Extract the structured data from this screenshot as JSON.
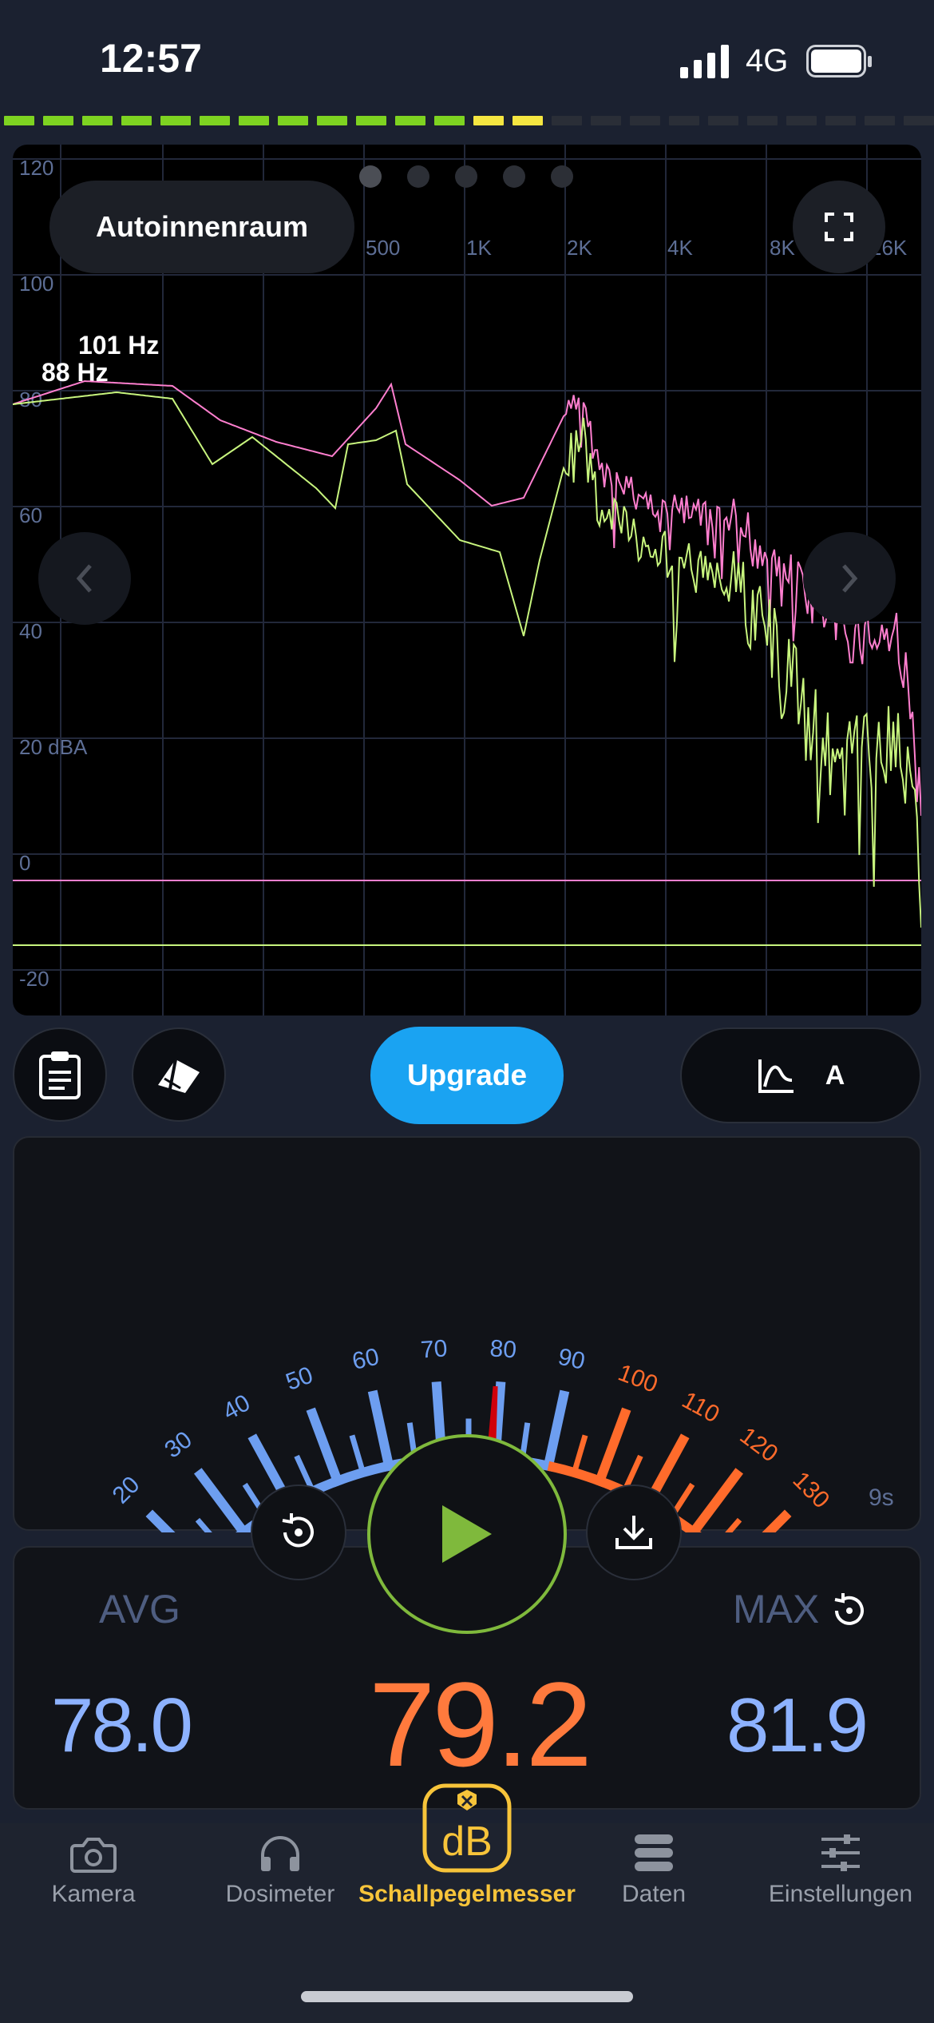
{
  "status": {
    "time": "12:57",
    "network": "4G"
  },
  "spectrum": {
    "preset_label": "Autoinnenraum",
    "y_ticks": [
      "120",
      "100",
      "80",
      "60",
      "40",
      "20 dBA",
      "0",
      "-20"
    ],
    "x_ticks": [
      "500",
      "1K",
      "2K",
      "4K",
      "8K",
      "16K"
    ],
    "peak_labels": [
      "101 Hz",
      "88 Hz"
    ],
    "colors": {
      "max_trace": "#ff7fcf",
      "current_trace": "#c8f57e",
      "grid": "#22283a"
    }
  },
  "toolbar": {
    "upgrade_label": "Upgrade",
    "weighting_label": "A"
  },
  "meter": {
    "scale_labels": [
      "20",
      "30",
      "40",
      "50",
      "60",
      "70",
      "80",
      "90",
      "100",
      "110",
      "120",
      "130"
    ],
    "needle_value": 79.2,
    "elapsed": "9s"
  },
  "stats": {
    "avg_label": "AVG",
    "avg_value": "78.0",
    "current_value": "79.2",
    "max_label": "MAX",
    "max_value": "81.9"
  },
  "tabs": [
    {
      "label": "Kamera",
      "icon": "camera-icon",
      "active": false
    },
    {
      "label": "Dosimeter",
      "icon": "headphones-icon",
      "active": false
    },
    {
      "label": "Schallpegelmesser",
      "icon": "db-badge-icon",
      "active": true
    },
    {
      "label": "Daten",
      "icon": "database-icon",
      "active": false
    },
    {
      "label": "Einstellungen",
      "icon": "sliders-icon",
      "active": false
    }
  ],
  "colors": {
    "accent": "#1aa3f2",
    "active_tab": "#f7c43a",
    "play_ring": "#7fb93c",
    "current_value": "#ff7a3d",
    "stat_value": "#8db2ff"
  }
}
